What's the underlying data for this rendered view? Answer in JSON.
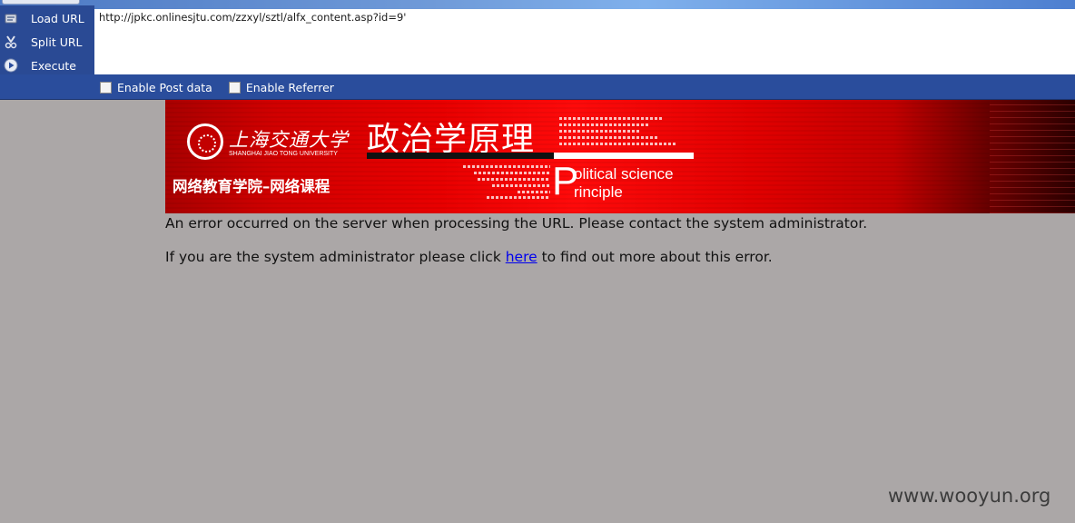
{
  "hackbar": {
    "buttons": {
      "load_url": "Load URL",
      "split_url": "Split URL",
      "execute": "Execute"
    },
    "url_value": "http://jpkc.onlinesjtu.com/zzxyl/sztl/alfx_content.asp?id=9'",
    "options": {
      "post_data": "Enable Post data",
      "referrer": "Enable Referrer"
    }
  },
  "banner": {
    "university_cn": "上海交通大学",
    "university_en": "SHANGHAI JIAO TONG UNIVERSITY",
    "school": "网络教育学院–网络课程",
    "course_cn": "政治学原理",
    "course_en_line1": "olitical science",
    "course_en_line2": "rinciple",
    "course_en_initial": "P"
  },
  "error": {
    "line1": "An error occurred on the server when processing the URL. Please contact the system administrator.",
    "line2_before": "If you are the system administrator please click ",
    "line2_link": "here",
    "line2_after": " to find out more about this error."
  },
  "watermark": "www.wooyun.org",
  "colors": {
    "toolbar_bg": "#2a4d9c",
    "page_bg": "#aba7a7",
    "banner_red": "#e80000",
    "link": "#0000ee"
  },
  "icons": {
    "load_url": "load-url-icon",
    "split_url": "split-url-icon",
    "execute": "execute-icon"
  }
}
